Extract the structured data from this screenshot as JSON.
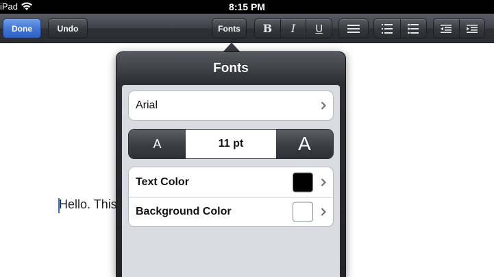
{
  "status_bar": {
    "carrier": "iPad",
    "time": "8:15 PM",
    "wifi_icon": "wifi-icon"
  },
  "toolbar": {
    "done_label": "Done",
    "undo_label": "Undo",
    "fonts_label": "Fonts",
    "bold_icon": "bold-icon",
    "italic_icon": "italic-icon",
    "underline_icon": "underline-icon",
    "align_icon": "align-justify-icon",
    "numbered_list_icon": "numbered-list-icon",
    "bullet_list_icon": "bullet-list-icon",
    "outdent_icon": "outdent-icon",
    "indent_icon": "indent-icon",
    "accent_color": "#3f74d4"
  },
  "document": {
    "visible_text": "Hello. This"
  },
  "popover": {
    "title": "Fonts",
    "font_name": "Arial",
    "size_decrease_label": "A",
    "size_value": "11 pt",
    "size_increase_label": "A",
    "text_color_label": "Text Color",
    "text_color": "#000000",
    "background_color_label": "Background Color",
    "background_color": "#ffffff"
  }
}
